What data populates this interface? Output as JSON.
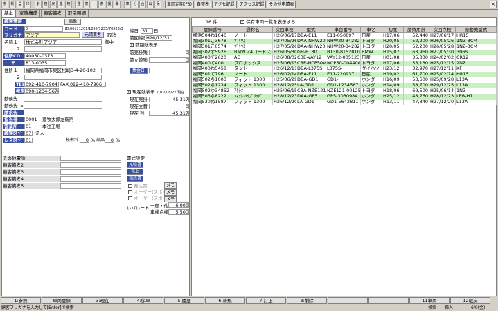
{
  "toolbar": {
    "icons": [
      "参照",
      "新規",
      "登録",
      "印刷",
      "削除",
      "複写",
      "戻る",
      "進む",
      "検索",
      "整列",
      "表示",
      "一覧",
      "条件",
      "設定",
      "開発",
      "車検",
      "分割",
      "合算",
      "出力",
      "保存"
    ],
    "buttons": [
      "車両定期(F3)",
      "自整表",
      "アクセ記録",
      "アクセス記録",
      "その他申請表"
    ]
  },
  "tabs": [
    "基本",
    "家族構成",
    "顧客備考",
    "取引明細"
  ],
  "customer": {
    "header_label": "顧客情報",
    "image_button": "画像",
    "code_label": "コード",
    "code": "2",
    "id_text": "ID:00111201/1055/1235/70523/3",
    "furigana_label": "フリガナ",
    "furigana": "アジア",
    "owner_btn": "元請業者",
    "type_label": "取消",
    "name1_label": "名称１",
    "name1": "株式会社アジア",
    "honorific": "御中",
    "name2_label": "２",
    "name2": "",
    "zip_label": "住所CD",
    "zip_code": "40050-0373",
    "postal_label": "〒",
    "postal": "813-0035",
    "addr1_label": "住所１",
    "addr1": "福岡県福岡市東区松崎3-4-20-102",
    "addr2_label": "２",
    "addr2": "",
    "tel_label": "TEL",
    "tel": "092-410-7904",
    "fax_label": "FAX",
    "fax": "092-410-7906",
    "mobile_label": "携帯",
    "mobile": "090-1234-5678",
    "work_label": "勤務先",
    "work": "",
    "worktel_label": "勤務先TEL",
    "worktel": "",
    "invoice_label": "請求先",
    "invoice": "",
    "staff_label": "担当者",
    "staff_code": "0001",
    "staff_name": "荒牧太郎左衛門",
    "office_label": "営業所",
    "office_code": "01",
    "office_name": "本社工場",
    "ctype_label": "顧客区分",
    "ctype_code": "07",
    "ctype_name": "法人",
    "tax_label": "レス区分",
    "tax_code": "01",
    "tax_rate_label": "技術料",
    "tax_rate": "0",
    "part_label": "部品",
    "part_rate": "0",
    "closing_label": "締日",
    "closing": "31",
    "closing_unit": "日",
    "prev_date_label": "前回締日",
    "prev_date": "H26/12/31",
    "prev_sales_check": "前回残表示",
    "prev_sales_label": "前売掛残",
    "prev_sales": "0",
    "prev_ret_label": "前立替残",
    "prev_ret": "0",
    "collect_btn": "集金日",
    "cur_check": "現在残表示",
    "cur_date": "2017/08/22 現在",
    "cur_sales_label": "現在売掛",
    "cur_sales": "45,317",
    "cur_ret_label": "現在立替",
    "cur_ret": "0",
    "cur_total_label": "現在 残",
    "cur_total": "45,317",
    "mail_label": "書式設定",
    "quote_btn": "見積書",
    "sales_btn": "売上",
    "inst_btn": "指示書",
    "opt1": "発注書",
    "opt2": "オーダー(スポット)",
    "opt3": "オーダー(スポット)",
    "memo_btn": "メモ",
    "rate_label": "レバレート",
    "rate_general_label": "一般・他",
    "rate_general": "6,000",
    "rate_check_label": "車検点検",
    "rate_check": "5,500",
    "other_phone_label": "その他電話",
    "notes": [
      "顧客備考2",
      "顧客備考3",
      "顧客備考4",
      "顧客備考5"
    ]
  },
  "vehicles": {
    "count": "16",
    "count_unit": "件",
    "show_kept": "保有車両一覧を表示する",
    "columns": [
      "登録番号",
      "通称名",
      "次回車検",
      "型式",
      "車台番号",
      "車名",
      "初度",
      "諸費用計",
      "次回点検",
      "原動機型式"
    ],
    "rows": [
      [
        "横浜504わ1046",
        "ノート",
        "H26/06/17",
        "DBA-E11",
        "E11-050897",
        "日産",
        "H17/06",
        "52,440",
        "H27/06/17",
        "HR15"
      ],
      [
        "福岡301こ3678",
        "ﾌﾟﾘｳｽ",
        "H27/05/26",
        "DAA-NHW20",
        "NHW20-342825",
        "トヨタ",
        "H20/05",
        "52,200",
        "H26/05/26",
        "1NZ-3CM"
      ],
      [
        "福岡301こ0574",
        "ﾌﾟﾘｳｽ",
        "H27/05/26",
        "DAA-NHW20",
        "NHW20-342825",
        "トヨタ",
        "H20/05",
        "52,200",
        "H26/05/28",
        "1NZ-3CM"
      ],
      [
        "福岡302す5926",
        "BMW Z4ロードスター",
        "H26/05/30",
        "GH-BT30",
        "BT30-8T52010",
        "BMW",
        "H15/07",
        "63,960",
        "H27/05/30",
        "306S"
      ],
      [
        "福岡400て2620",
        "AD",
        "H26/08/02",
        "CBE-VAY12",
        "VAY12-005123",
        "日産",
        "H01/08",
        "35,330",
        "H24/02/02",
        "CR12"
      ],
      [
        "福岡400て400",
        "プロボックス",
        "H25/06/15",
        "CBE-NCP50V",
        "NCP50-004400",
        "トヨタ",
        "H17/06",
        "33,130",
        "H25/12/15",
        "2NZ"
      ],
      [
        "福岡400わ5458",
        "タント",
        "H26/12/11",
        "DBA-L375S",
        "L375S-",
        "ダイハツ",
        "H23/12",
        "32,970",
        "H27/12/11",
        "KF"
      ],
      [
        "福岡501て796",
        "ノート",
        "H26/02/14",
        "DBA-E11",
        "E11-220937",
        "日産",
        "H19/02",
        "61,700",
        "H25/02/14",
        "HR15"
      ],
      [
        "福岡502ち1003",
        "フィット 1300",
        "H25/06/29",
        "DBA-GD1",
        "GD1-",
        "ホンダ",
        "H16/09",
        "53,500",
        "H25/09/28",
        "L13A"
      ],
      [
        "福岡502ち1234",
        "フィット 1300",
        "H28/12/25",
        "LA-GD1",
        "GD1-1234567",
        "ホンダ",
        "H14/09",
        "58,700",
        "H29/12/25",
        "L13A"
      ],
      [
        "福岡502ゆ34852",
        "ｱｸｼｵ",
        "H25/06/15",
        "CBA-NZE121",
        "NZE121-001254",
        "トヨタ",
        "H18/06",
        "69,500",
        "H25/06/14",
        "1NZ"
      ],
      [
        "福岡503ち8222",
        "ﾌｨｯﾄ ﾊｲﾌﾞﾘｯﾄﾞ",
        "H28/12/23",
        "DAA-GP5",
        "GP5-3030984",
        "ホンダ",
        "H25/12",
        "48,760",
        "H28/12/23",
        "LEB-H1"
      ],
      [
        "福岡530ね1587",
        "フィット 1300",
        "H26/12/20",
        "LA-GD1",
        "GD1-5642811",
        "ホンダ",
        "H13/11",
        "47,840",
        "H27/12/20",
        "L13A"
      ]
    ]
  },
  "fkeys": [
    "1:参照",
    "車両登録",
    "3:現在",
    "4:保車",
    "5:履歴",
    "6:新規",
    "7:訂正",
    "8:削除",
    "",
    "",
    "11車両",
    "12取戻"
  ],
  "status": {
    "msg": "顧客フリガナを入力して[Enter]で検索",
    "left": "検索",
    "mode": "挿入",
    "page": "6/0(金)"
  }
}
